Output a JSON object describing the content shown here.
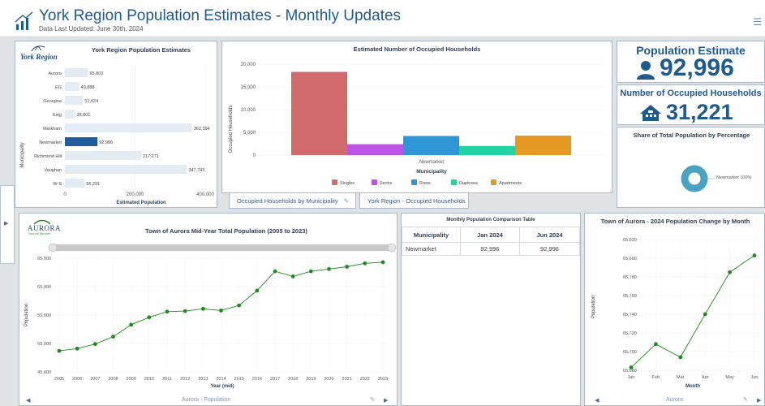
{
  "header": {
    "title": "York Region Population Estimates - Monthly Updates",
    "subtitle": "Data Last Updated: June 30th, 2024"
  },
  "muni_chart": {
    "logo_text": "York Region",
    "title": "York Region Population Estimates",
    "ylabel": "Municipality",
    "xlabel": "Estimated Population",
    "ticks": [
      "0",
      "200,000",
      "400,000"
    ]
  },
  "households_chart": {
    "title": "Estimated Number of Occupied Households",
    "ylabel": "Occupied Households",
    "xlabel": "Municipality",
    "category": "Newmarket",
    "ticks": [
      "0",
      "5,000",
      "10,000",
      "15,000",
      "20,000"
    ],
    "tabs": [
      "Occupied Households by Municipality",
      "York Region - Occupied Households"
    ]
  },
  "kpi": {
    "pop_title": "Population Estimate",
    "pop_value": "92,996",
    "hh_title": "Number of Occupied Households",
    "hh_value": "31,221",
    "share_title": "Share of Total Population by Percentage",
    "share_label": "Newmarket 100%"
  },
  "aurora_chart": {
    "logo_text": "AURORA",
    "logo_sub": "Yours to discover",
    "title": "Town of Aurora Mid-Year Total Population (2005 to 2023)",
    "ylabel": "Population",
    "xlabel": "Year (mid)",
    "yticks": [
      "45,000",
      "50,000",
      "55,000",
      "60,000",
      "65,000"
    ],
    "footer": "Aurora - Population"
  },
  "comparison": {
    "title": "Monthly Population Comparison Table",
    "headers": [
      "Municipality",
      "Jan 2024",
      "Jun 2024"
    ],
    "rows": [
      [
        "Newmarket",
        "92,996",
        "92,996"
      ]
    ]
  },
  "monthly_chart": {
    "title": "Town of Aurora - 2024 Population Change by Month",
    "ylabel": "Population",
    "xlabel": "Month",
    "yticks": [
      "65,680",
      "65,700",
      "65,720",
      "65,740",
      "65,760",
      "65,780",
      "65,800",
      "65,820"
    ],
    "footer": "Aurora"
  },
  "colors": {
    "accent": "#1e5a8e",
    "bar_light": "#e3ebf3",
    "bar_selected": "#1f5d9e",
    "line": "#1f8a1f"
  },
  "chart_data": [
    {
      "type": "bar",
      "title": "York Region Population Estimates",
      "orientation": "horizontal",
      "xlabel": "Estimated Population",
      "ylabel": "Municipality",
      "categories": [
        "Aurora",
        "EG",
        "Georgina",
        "King",
        "Markham",
        "Newmarket",
        "Richmond Hill",
        "Vaughan",
        "W-S"
      ],
      "values": [
        65803,
        40888,
        51624,
        28801,
        362394,
        92996,
        217271,
        347743,
        56291
      ],
      "labels": [
        "65,803",
        "40,888",
        "51,624",
        "28,801",
        "362,394",
        "92,996",
        "217,271",
        "347,743",
        "56,291"
      ],
      "selected": "Newmarket",
      "xlim": [
        0,
        400000
      ]
    },
    {
      "type": "bar",
      "title": "Estimated Number of Occupied Households",
      "xlabel": "Municipality",
      "ylabel": "Occupied Households",
      "categories": [
        "Newmarket"
      ],
      "series": [
        {
          "name": "Singles",
          "values": [
            18300
          ],
          "color": "#d16b6b"
        },
        {
          "name": "Semis",
          "values": [
            2400
          ],
          "color": "#b954e6"
        },
        {
          "name": "Rows",
          "values": [
            4200
          ],
          "color": "#2f96d6"
        },
        {
          "name": "Duplexes",
          "values": [
            2000
          ],
          "color": "#22d2a2"
        },
        {
          "name": "Apartments",
          "values": [
            4300
          ],
          "color": "#e69a24"
        }
      ],
      "ylim": [
        0,
        20000
      ]
    },
    {
      "type": "pie",
      "title": "Share of Total Population by Percentage",
      "categories": [
        "Newmarket"
      ],
      "values": [
        100
      ]
    },
    {
      "type": "line",
      "title": "Town of Aurora Mid-Year Total Population (2005 to 2023)",
      "xlabel": "Year (mid)",
      "ylabel": "Population",
      "x": [
        "2005",
        "2006",
        "2007",
        "2008",
        "2009",
        "2010",
        "2011",
        "2012",
        "2013",
        "2014",
        "2015",
        "2016",
        "2017",
        "2018",
        "2019",
        "2020",
        "2021",
        "2022",
        "2023"
      ],
      "values": [
        48700,
        49100,
        49900,
        51200,
        53300,
        54600,
        55600,
        55700,
        56100,
        55800,
        56700,
        59300,
        62700,
        61800,
        62700,
        63100,
        63500,
        64100,
        64300
      ],
      "ylim": [
        45000,
        65000
      ]
    },
    {
      "type": "line",
      "title": "Town of Aurora - 2024 Population Change by Month",
      "xlabel": "Month",
      "ylabel": "Population",
      "x": [
        "Jan",
        "Feb",
        "Mar",
        "Apr",
        "May",
        "Jun"
      ],
      "values": [
        65683,
        65708,
        65694,
        65740,
        65785,
        65803
      ],
      "ylim": [
        65680,
        65820
      ]
    }
  ]
}
